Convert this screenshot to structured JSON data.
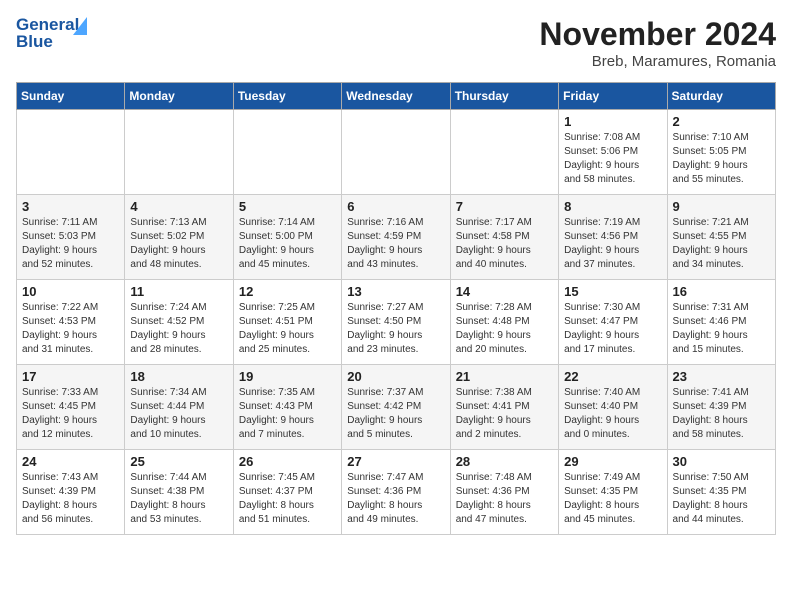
{
  "header": {
    "logo_general": "General",
    "logo_blue": "Blue",
    "month_year": "November 2024",
    "location": "Breb, Maramures, Romania"
  },
  "weekdays": [
    "Sunday",
    "Monday",
    "Tuesday",
    "Wednesday",
    "Thursday",
    "Friday",
    "Saturday"
  ],
  "weeks": [
    [
      {
        "day": "",
        "info": ""
      },
      {
        "day": "",
        "info": ""
      },
      {
        "day": "",
        "info": ""
      },
      {
        "day": "",
        "info": ""
      },
      {
        "day": "",
        "info": ""
      },
      {
        "day": "1",
        "info": "Sunrise: 7:08 AM\nSunset: 5:06 PM\nDaylight: 9 hours\nand 58 minutes."
      },
      {
        "day": "2",
        "info": "Sunrise: 7:10 AM\nSunset: 5:05 PM\nDaylight: 9 hours\nand 55 minutes."
      }
    ],
    [
      {
        "day": "3",
        "info": "Sunrise: 7:11 AM\nSunset: 5:03 PM\nDaylight: 9 hours\nand 52 minutes."
      },
      {
        "day": "4",
        "info": "Sunrise: 7:13 AM\nSunset: 5:02 PM\nDaylight: 9 hours\nand 48 minutes."
      },
      {
        "day": "5",
        "info": "Sunrise: 7:14 AM\nSunset: 5:00 PM\nDaylight: 9 hours\nand 45 minutes."
      },
      {
        "day": "6",
        "info": "Sunrise: 7:16 AM\nSunset: 4:59 PM\nDaylight: 9 hours\nand 43 minutes."
      },
      {
        "day": "7",
        "info": "Sunrise: 7:17 AM\nSunset: 4:58 PM\nDaylight: 9 hours\nand 40 minutes."
      },
      {
        "day": "8",
        "info": "Sunrise: 7:19 AM\nSunset: 4:56 PM\nDaylight: 9 hours\nand 37 minutes."
      },
      {
        "day": "9",
        "info": "Sunrise: 7:21 AM\nSunset: 4:55 PM\nDaylight: 9 hours\nand 34 minutes."
      }
    ],
    [
      {
        "day": "10",
        "info": "Sunrise: 7:22 AM\nSunset: 4:53 PM\nDaylight: 9 hours\nand 31 minutes."
      },
      {
        "day": "11",
        "info": "Sunrise: 7:24 AM\nSunset: 4:52 PM\nDaylight: 9 hours\nand 28 minutes."
      },
      {
        "day": "12",
        "info": "Sunrise: 7:25 AM\nSunset: 4:51 PM\nDaylight: 9 hours\nand 25 minutes."
      },
      {
        "day": "13",
        "info": "Sunrise: 7:27 AM\nSunset: 4:50 PM\nDaylight: 9 hours\nand 23 minutes."
      },
      {
        "day": "14",
        "info": "Sunrise: 7:28 AM\nSunset: 4:48 PM\nDaylight: 9 hours\nand 20 minutes."
      },
      {
        "day": "15",
        "info": "Sunrise: 7:30 AM\nSunset: 4:47 PM\nDaylight: 9 hours\nand 17 minutes."
      },
      {
        "day": "16",
        "info": "Sunrise: 7:31 AM\nSunset: 4:46 PM\nDaylight: 9 hours\nand 15 minutes."
      }
    ],
    [
      {
        "day": "17",
        "info": "Sunrise: 7:33 AM\nSunset: 4:45 PM\nDaylight: 9 hours\nand 12 minutes."
      },
      {
        "day": "18",
        "info": "Sunrise: 7:34 AM\nSunset: 4:44 PM\nDaylight: 9 hours\nand 10 minutes."
      },
      {
        "day": "19",
        "info": "Sunrise: 7:35 AM\nSunset: 4:43 PM\nDaylight: 9 hours\nand 7 minutes."
      },
      {
        "day": "20",
        "info": "Sunrise: 7:37 AM\nSunset: 4:42 PM\nDaylight: 9 hours\nand 5 minutes."
      },
      {
        "day": "21",
        "info": "Sunrise: 7:38 AM\nSunset: 4:41 PM\nDaylight: 9 hours\nand 2 minutes."
      },
      {
        "day": "22",
        "info": "Sunrise: 7:40 AM\nSunset: 4:40 PM\nDaylight: 9 hours\nand 0 minutes."
      },
      {
        "day": "23",
        "info": "Sunrise: 7:41 AM\nSunset: 4:39 PM\nDaylight: 8 hours\nand 58 minutes."
      }
    ],
    [
      {
        "day": "24",
        "info": "Sunrise: 7:43 AM\nSunset: 4:39 PM\nDaylight: 8 hours\nand 56 minutes."
      },
      {
        "day": "25",
        "info": "Sunrise: 7:44 AM\nSunset: 4:38 PM\nDaylight: 8 hours\nand 53 minutes."
      },
      {
        "day": "26",
        "info": "Sunrise: 7:45 AM\nSunset: 4:37 PM\nDaylight: 8 hours\nand 51 minutes."
      },
      {
        "day": "27",
        "info": "Sunrise: 7:47 AM\nSunset: 4:36 PM\nDaylight: 8 hours\nand 49 minutes."
      },
      {
        "day": "28",
        "info": "Sunrise: 7:48 AM\nSunset: 4:36 PM\nDaylight: 8 hours\nand 47 minutes."
      },
      {
        "day": "29",
        "info": "Sunrise: 7:49 AM\nSunset: 4:35 PM\nDaylight: 8 hours\nand 45 minutes."
      },
      {
        "day": "30",
        "info": "Sunrise: 7:50 AM\nSunset: 4:35 PM\nDaylight: 8 hours\nand 44 minutes."
      }
    ]
  ]
}
